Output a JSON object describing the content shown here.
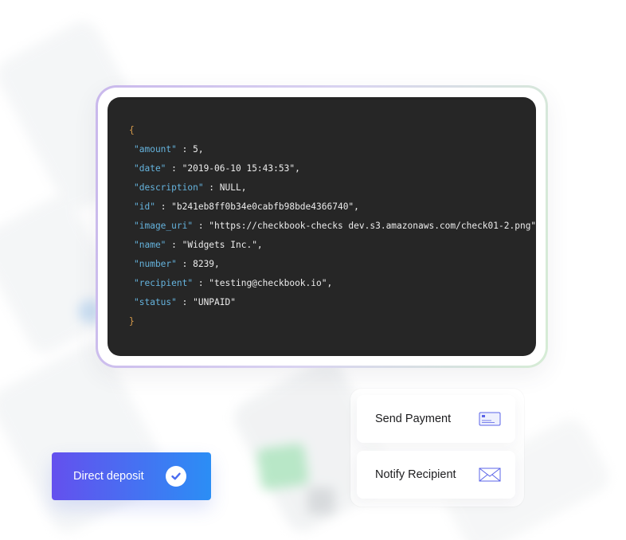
{
  "code": {
    "open_brace": "{",
    "close_brace": "}",
    "lines": [
      {
        "key": "\"amount\"",
        "rest": " : 5,"
      },
      {
        "key": "\"date\"",
        "rest": " : \"2019-06-10 15:43:53\","
      },
      {
        "key": "\"description\"",
        "rest": " : NULL,"
      },
      {
        "key": "\"id\"",
        "rest": " : \"b241eb8ff0b34e0cabfb98bde4366740\","
      },
      {
        "key": "\"image_uri\"",
        "rest": " : \"https://checkbook-checks dev.s3.amazonaws.com/check01-2.png\","
      },
      {
        "key": "\"name\"",
        "rest": " : \"Widgets Inc.\","
      },
      {
        "key": "\"number\"",
        "rest": " : 8239,"
      },
      {
        "key": "\"recipient\"",
        "rest": " : \"testing@checkbook.io\","
      },
      {
        "key": "\"status\"",
        "rest": " : \"UNPAID\""
      }
    ]
  },
  "actions": {
    "send_payment": {
      "label": "Send Payment",
      "icon": "credit-card-icon"
    },
    "notify_recipient": {
      "label": "Notify Recipient",
      "icon": "envelope-icon"
    }
  },
  "deposit": {
    "label": "Direct deposit",
    "icon": "checkmark-icon"
  },
  "colors": {
    "code_bg": "#262626",
    "json_key": "#65b3dd",
    "json_brace": "#d79b4b",
    "deposit_gradient_start": "#6450ee",
    "deposit_gradient_end": "#2b8ef5",
    "icon_stroke": "#5b64e8"
  }
}
